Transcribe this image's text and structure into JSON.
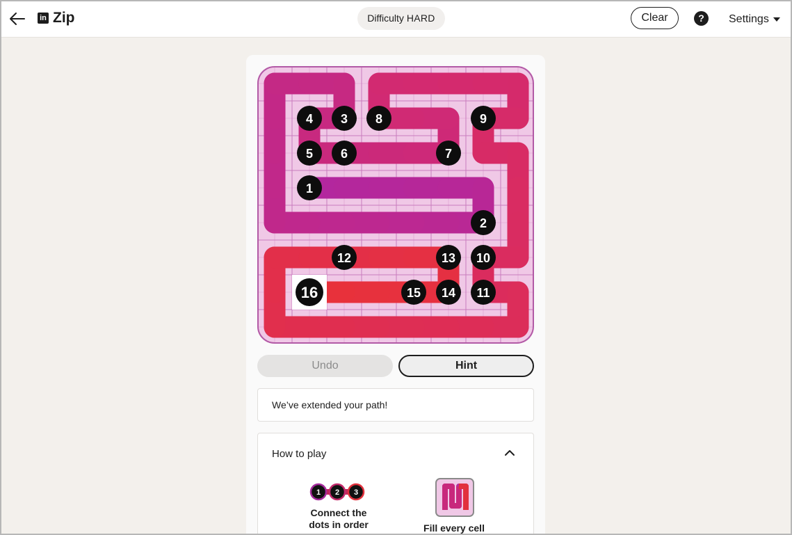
{
  "header": {
    "app_name": "Zip",
    "logo_glyph": "in",
    "difficulty_label": "Difficulty",
    "difficulty_level": "HARD",
    "clear_label": "Clear",
    "help_glyph": "?",
    "settings_label": "Settings"
  },
  "puzzle": {
    "grid_size": 8,
    "numbers": [
      {
        "n": "1",
        "row": 3,
        "col": 1
      },
      {
        "n": "2",
        "row": 4,
        "col": 6
      },
      {
        "n": "3",
        "row": 1,
        "col": 2
      },
      {
        "n": "4",
        "row": 1,
        "col": 1
      },
      {
        "n": "5",
        "row": 2,
        "col": 1
      },
      {
        "n": "6",
        "row": 2,
        "col": 2
      },
      {
        "n": "7",
        "row": 2,
        "col": 5
      },
      {
        "n": "8",
        "row": 1,
        "col": 3
      },
      {
        "n": "9",
        "row": 1,
        "col": 6
      },
      {
        "n": "10",
        "row": 5,
        "col": 6
      },
      {
        "n": "11",
        "row": 6,
        "col": 6
      },
      {
        "n": "12",
        "row": 5,
        "col": 2
      },
      {
        "n": "13",
        "row": 5,
        "col": 5
      },
      {
        "n": "14",
        "row": 6,
        "col": 5
      },
      {
        "n": "15",
        "row": 6,
        "col": 4
      },
      {
        "n": "16",
        "row": 6,
        "col": 1
      }
    ],
    "colors": {
      "path_start": "#b3279e",
      "path_mid": "#d42a6e",
      "path_end": "#e8313b",
      "cell_fill": "#f0c8e6",
      "grid_line": "#c97bbd",
      "board_border": "#b25aa6",
      "number_dot": "#0d0d0d"
    }
  },
  "controls": {
    "undo_label": "Undo",
    "hint_label": "Hint"
  },
  "message": "We’ve extended your path!",
  "how_to_play": {
    "title": "How to play",
    "step1_line1": "Connect the",
    "step1_line2": "dots in order",
    "step1_dots": [
      "1",
      "2",
      "3"
    ],
    "step2": "Fill every cell"
  }
}
